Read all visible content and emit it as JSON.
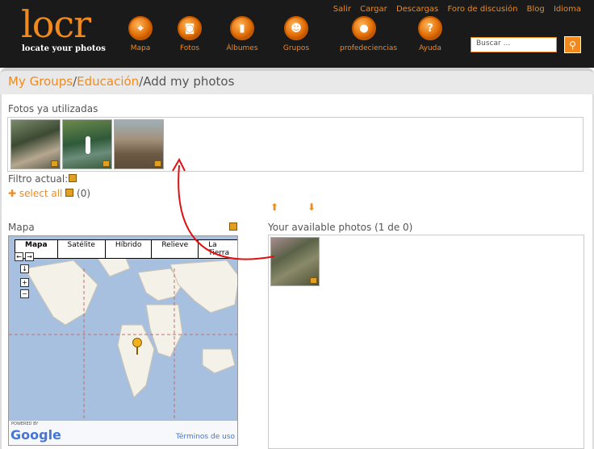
{
  "header": {
    "logo": "locr",
    "tagline": "locate your photos",
    "toplinks": [
      "Salir",
      "Cargar",
      "Descargas",
      "Foro de discusión",
      "Blog",
      "Idioma"
    ],
    "nav": [
      {
        "label": "Mapa",
        "icon": "map-icon"
      },
      {
        "label": "Fotos",
        "icon": "camera-icon"
      },
      {
        "label": "Álbumes",
        "icon": "album-icon"
      },
      {
        "label": "Grupos",
        "icon": "groups-icon"
      },
      {
        "label": "profedeciencias",
        "icon": "user-icon"
      },
      {
        "label": "Ayuda",
        "icon": "help-icon"
      }
    ],
    "search_placeholder": "Buscar ...",
    "accent": "#f08a1e"
  },
  "breadcrumb": {
    "groups": "My Groups",
    "sep1": "/",
    "group": "Educación",
    "sep2": "/",
    "current": "Add my photos"
  },
  "used": {
    "title": "Fotos ya utilizadas",
    "filter_label": "Filtro actual:",
    "select_all": "select all",
    "count": "(0)"
  },
  "map": {
    "title": "Mapa",
    "tabs": [
      "Mapa",
      "Satélite",
      "Híbrido",
      "Relieve",
      "La Tierra"
    ],
    "selected_tab": "Mapa",
    "powered_by": "POWERED BY",
    "google": "Google",
    "terms": "Términos de uso"
  },
  "available": {
    "title": "Your available photos (1 de 0)"
  }
}
